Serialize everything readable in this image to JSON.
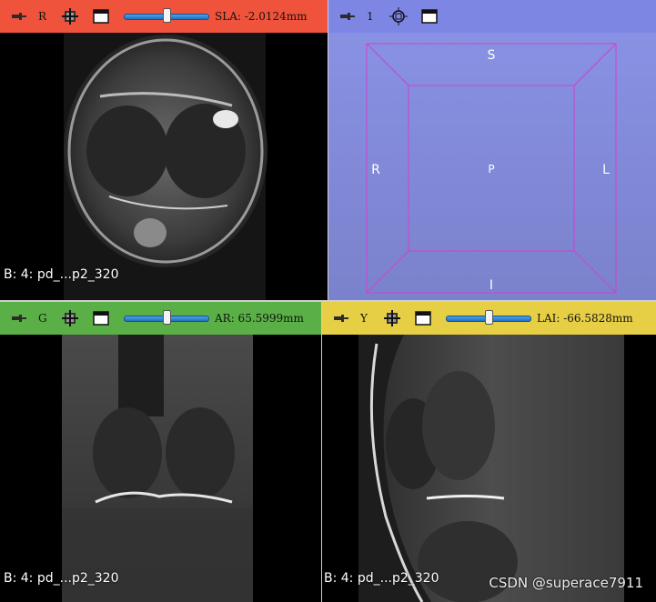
{
  "views": {
    "red": {
      "bar_color": "#f0533c",
      "label": "R",
      "slider_fraction": 0.5,
      "value": "SLA: -2.0124mm",
      "volume": "B: 4: pd_...p2_320"
    },
    "view3d": {
      "bar_color": "#7d86e3",
      "label": "1",
      "orientation": {
        "top": "S",
        "left": "R",
        "right": "L",
        "center": "P",
        "bottom": "I"
      }
    },
    "green": {
      "bar_color": "#5ab046",
      "label": "G",
      "slider_fraction": 0.5,
      "value": "AR: 65.5999mm",
      "volume": "B: 4: pd_...p2_320"
    },
    "yellow": {
      "bar_color": "#e6cf45",
      "label": "Y",
      "slider_fraction": 0.5,
      "value": "LAI: -66.5828mm",
      "volume": "B: 4: pd_...p2_320"
    }
  },
  "watermark": "CSDN @superace7911",
  "icons": [
    "pin-icon",
    "link-icon",
    "maximize-icon",
    "center-icon"
  ]
}
